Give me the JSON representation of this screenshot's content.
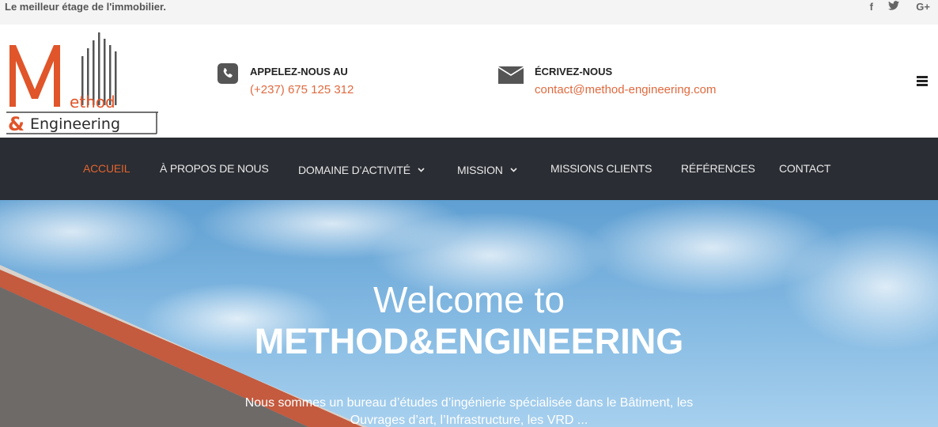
{
  "topbar": {
    "tagline": "Le meilleur étage de l'immobilier.",
    "social": [
      {
        "icon": "facebook-icon",
        "glyph": "f"
      },
      {
        "icon": "twitter-icon",
        "glyph": "🐦"
      },
      {
        "icon": "google-plus-icon",
        "glyph": "G+"
      }
    ]
  },
  "header": {
    "logo": {
      "word1_rest": "ethod",
      "ampersand": "&",
      "word2": "Engineering",
      "brand_color": "#e0552a"
    },
    "phone": {
      "title": "APPELEZ-NOUS AU",
      "value": "(+237) 675 125 312",
      "icon": "phone-icon"
    },
    "email": {
      "title": "ÉCRIVEZ-NOUS",
      "value": "contact@method-engineering.com",
      "icon": "envelope-icon"
    },
    "menu_icon": "hamburger-menu-icon"
  },
  "nav": {
    "items": [
      {
        "label": "ACCUEIL",
        "active": true,
        "dropdown": false
      },
      {
        "label": "À PROPOS DE NOUS",
        "active": false,
        "dropdown": false
      },
      {
        "label": "DOMAINE D’ACTIVITÉ",
        "active": false,
        "dropdown": true
      },
      {
        "label": "MISSION",
        "active": false,
        "dropdown": true
      },
      {
        "label": "MISSIONS CLIENTS",
        "active": false,
        "dropdown": false
      },
      {
        "label": "RÉFÉRENCES",
        "active": false,
        "dropdown": false
      },
      {
        "label": "CONTACT",
        "active": false,
        "dropdown": false
      }
    ],
    "active_color": "#e0642f",
    "background": "#2a2d33"
  },
  "hero": {
    "welcome": "Welcome to",
    "brand": "METHOD&ENGINEERING",
    "description": "Nous sommes un bureau d’études d’ingénierie spécialisée dans le Bâtiment, les Ouvrages d’art, l’Infrastructure, les VRD ..."
  }
}
